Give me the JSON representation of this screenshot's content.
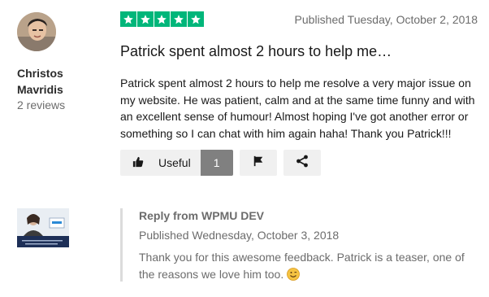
{
  "author": {
    "name": "Christos Mavridis",
    "reviews_count": "2 reviews"
  },
  "review": {
    "rating": 5,
    "rating_max": 5,
    "star_color": "#00b67a",
    "published": "Published Tuesday, October 2, 2018",
    "title": "Patrick spent almost 2 hours to help me…",
    "body": "Patrick spent almost 2 hours to help me resolve a very major issue on my website. He was patient, calm and at the same time funny and with an excellent sense of humour! Almost hoping I've got another error or something so I can chat with him again haha! Thank you Patrick!!!"
  },
  "actions": {
    "useful_label": "Useful",
    "useful_count": "1",
    "useful_icon": "thumbs-up-icon",
    "flag_icon": "flag-icon",
    "share_icon": "share-icon"
  },
  "reply": {
    "from": "Reply from WPMU DEV",
    "published": "Published Wednesday, October 3, 2018",
    "body": "Thank you for this awesome feedback. Patrick is a teaser, one of the reasons we love him too.",
    "emoji": "smiley-emoji"
  }
}
